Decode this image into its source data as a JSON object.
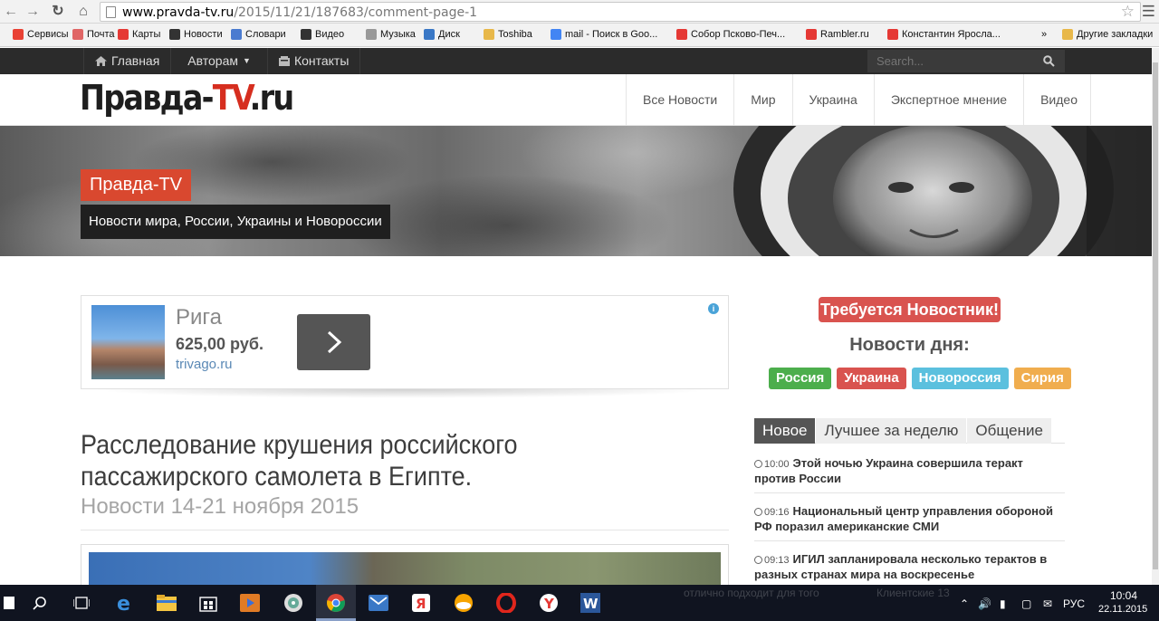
{
  "browser": {
    "url_host": "www.pravda-tv.ru",
    "url_path": "/2015/11/21/187683/comment-page-1",
    "bookmarks": [
      {
        "label": "Сервисы",
        "color": "#e94235"
      },
      {
        "label": "Почта",
        "color": "#e06666"
      },
      {
        "label": "Карты",
        "color": "#e53935"
      },
      {
        "label": "Новости",
        "color": "#333333"
      },
      {
        "label": "Словари",
        "color": "#4a7bd0"
      },
      {
        "label": "Видео",
        "color": "#333333"
      },
      {
        "label": "Музыка",
        "color": "#999999"
      },
      {
        "label": "Диск",
        "color": "#3a78c6"
      },
      {
        "label": "Toshiba",
        "color": "#e8b84a"
      },
      {
        "label": "mail - Поиск в Goo...",
        "color": "#4285f4"
      },
      {
        "label": "Собор Псково-Печ...",
        "color": "#e53935"
      },
      {
        "label": "Rambler.ru",
        "color": "#e53935"
      },
      {
        "label": "Константин Яросла...",
        "color": "#e53935"
      }
    ],
    "more_bookmarks": "»",
    "other_bookmarks": "Другие закладки"
  },
  "topbar": {
    "home": "Главная",
    "authors": "Авторам",
    "contacts": "Контакты",
    "search_placeholder": "Search..."
  },
  "header": {
    "logo_main": "Правда-",
    "logo_tv": "TV",
    "logo_ru": ".ru",
    "nav": [
      "Все Новости",
      "Мир",
      "Украина",
      "Экспертное мнение",
      "Видео"
    ]
  },
  "hero": {
    "badge": "Правда-TV",
    "subtitle": "Новости мира, России, Украины и Новороссии"
  },
  "ad": {
    "city": "Рига",
    "price": "625,00 руб.",
    "site": "trivago.ru",
    "info": "i"
  },
  "article": {
    "title": "Расследование крушения российского пассажирского самолета в Египте.",
    "subtitle": "Новости 14-21 ноября 2015"
  },
  "sidebar": {
    "wanted": "Требуется Новостник!",
    "news_day": "Новости дня:",
    "tags": [
      {
        "label": "Россия",
        "color": "#4cae4c"
      },
      {
        "label": "Украина",
        "color": "#d9534f"
      },
      {
        "label": "Новороссия",
        "color": "#5bc0de"
      },
      {
        "label": "Сирия",
        "color": "#f0ad4e"
      }
    ],
    "tabs": [
      "Новое",
      "Лучшее за неделю",
      "Общение"
    ],
    "news": [
      {
        "time": "10:00",
        "text": "Этой ночью Украина совершила теракт против России"
      },
      {
        "time": "09:16",
        "text": "Национальный центр управления обороной РФ поразил американские СМИ"
      },
      {
        "time": "09:13",
        "text": "ИГИЛ запланировала несколько терактов в разных странах мира на воскресенье"
      }
    ]
  },
  "taskbar": {
    "lang": "РУС",
    "time": "10:04",
    "date": "22.11.2015",
    "ghost_texts": [
      "отлично подходит для того",
      "Клиентские 13"
    ]
  }
}
